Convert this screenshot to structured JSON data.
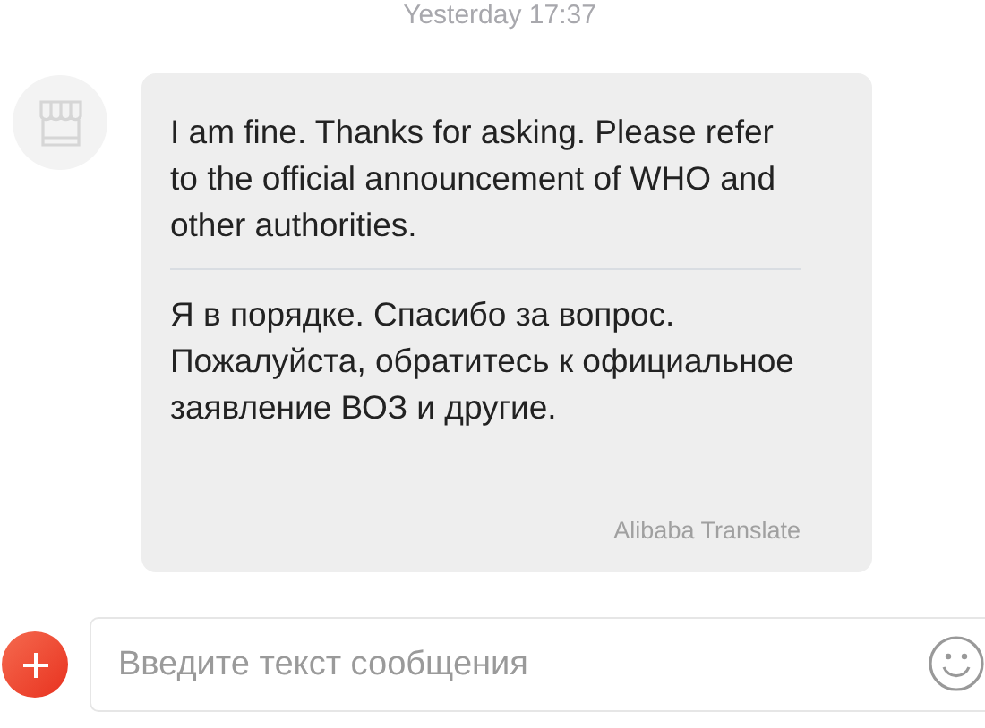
{
  "timestamp": "Yesterday 17:37",
  "message": {
    "original": "I am fine. Thanks for asking. Please refer to the official announcement of WHO and other authorities.",
    "translation": "Я в порядке. Спасибо за вопрос. Пожалуйста, обратитесь к официальное заявление ВОЗ и другие.",
    "translator": "Alibaba Translate"
  },
  "composer": {
    "placeholder": "Введите текст сообщения"
  }
}
